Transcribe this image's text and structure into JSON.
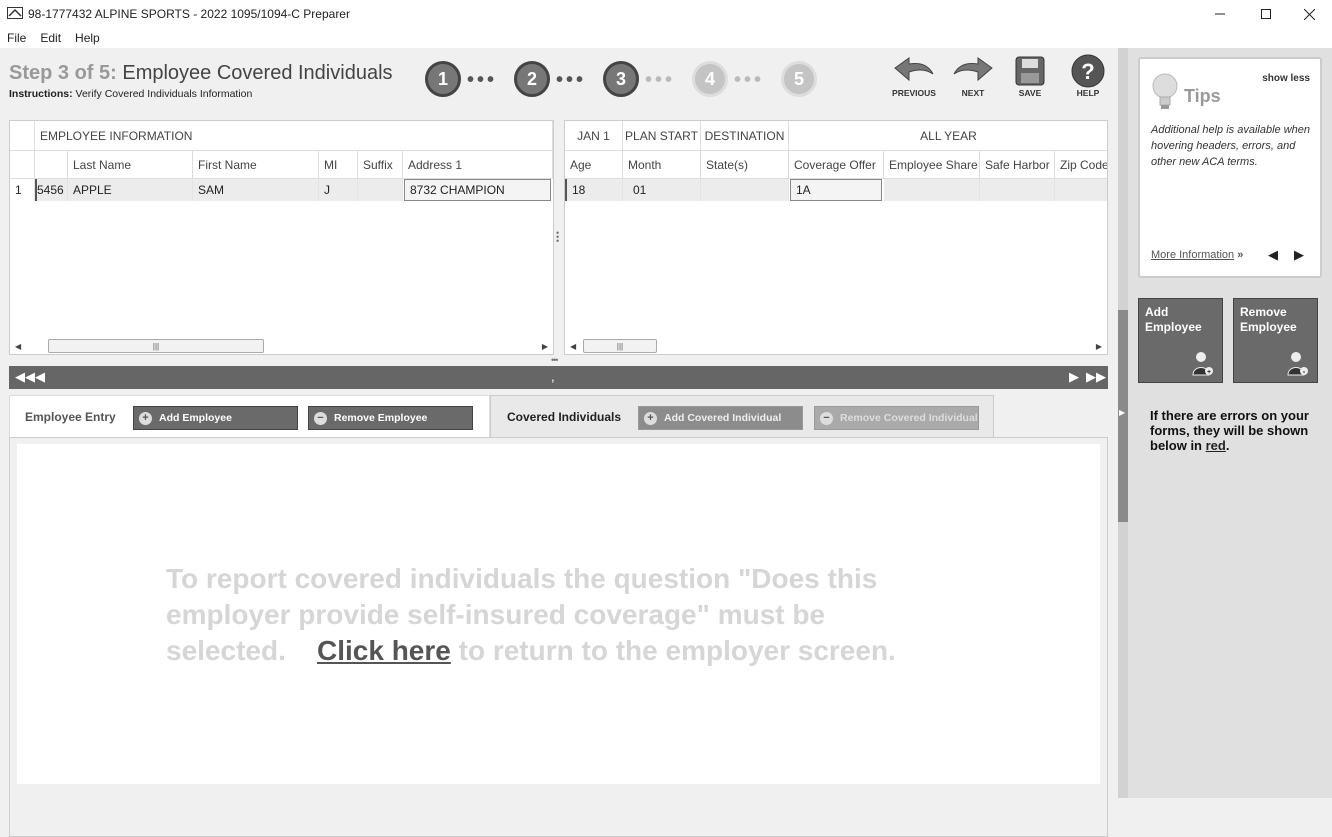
{
  "window": {
    "title": "98-1777432 ALPINE SPORTS - 2022 1095/1094-C Preparer",
    "minimize": "—",
    "maximize": "☐",
    "close": "✕"
  },
  "menu": [
    "File",
    "Edit",
    "Help"
  ],
  "header": {
    "step_label": "Step 3 of 5:",
    "step_title": "Employee Covered Individuals",
    "instructions_label": "Instructions:",
    "instructions_text": "Verify Covered Individuals Information",
    "steps": [
      "1",
      "2",
      "3",
      "4",
      "5"
    ],
    "current_step": 3,
    "nav": {
      "previous": "PREVIOUS",
      "next": "NEXT",
      "save": "SAVE",
      "help": "HELP"
    }
  },
  "left_grid": {
    "group_header": "EMPLOYEE INFORMATION",
    "columns": [
      "Last Name",
      "First Name",
      "MI",
      "Suffix",
      "Address 1"
    ],
    "rows": [
      {
        "num": "1",
        "ssn": "5456",
        "last": "APPLE",
        "first": "SAM",
        "mi": "J",
        "suffix": "",
        "address1": "8732 CHAMPION"
      }
    ]
  },
  "right_grid": {
    "group_headers": [
      "JAN 1",
      "PLAN START",
      "DESTINATION",
      "ALL YEAR"
    ],
    "columns": [
      "Age",
      "Month",
      "State(s)",
      "Coverage Offer",
      "Employee Share",
      "Safe Harbor",
      "Zip Code"
    ],
    "rows": [
      {
        "age": "18",
        "month": "01",
        "states": "",
        "coverage_offer": "1A",
        "employee_share": "",
        "safe_harbor": "",
        "zip": ""
      }
    ]
  },
  "nav_bar": {
    "center_text": ","
  },
  "tabs": {
    "employee_entry": {
      "label": "Employee Entry",
      "add": "Add Employee",
      "remove": "Remove Employee"
    },
    "covered_individuals": {
      "label": "Covered Individuals",
      "add": "Add Covered Individual",
      "remove": "Remove Covered Individual"
    }
  },
  "message": {
    "line1": "To report covered individuals the question \"Does this",
    "line2": "employer provide self-insured coverage\" must be",
    "line3_pre": "selected.",
    "link": "Click here",
    "line3_post": "to return to the employer screen."
  },
  "sidebar": {
    "tips": {
      "show_less": "show less",
      "title": "Tips",
      "text": "Additional help is available when hovering headers, errors, and other new ACA terms.",
      "more_info": "More Information",
      "more_info_suffix": "»"
    },
    "add_employee": "Add Employee",
    "remove_employee": "Remove Employee",
    "error_note_pre": "If there are errors on your forms, they will be shown below in",
    "error_note_link": "red",
    "error_note_post": "."
  }
}
